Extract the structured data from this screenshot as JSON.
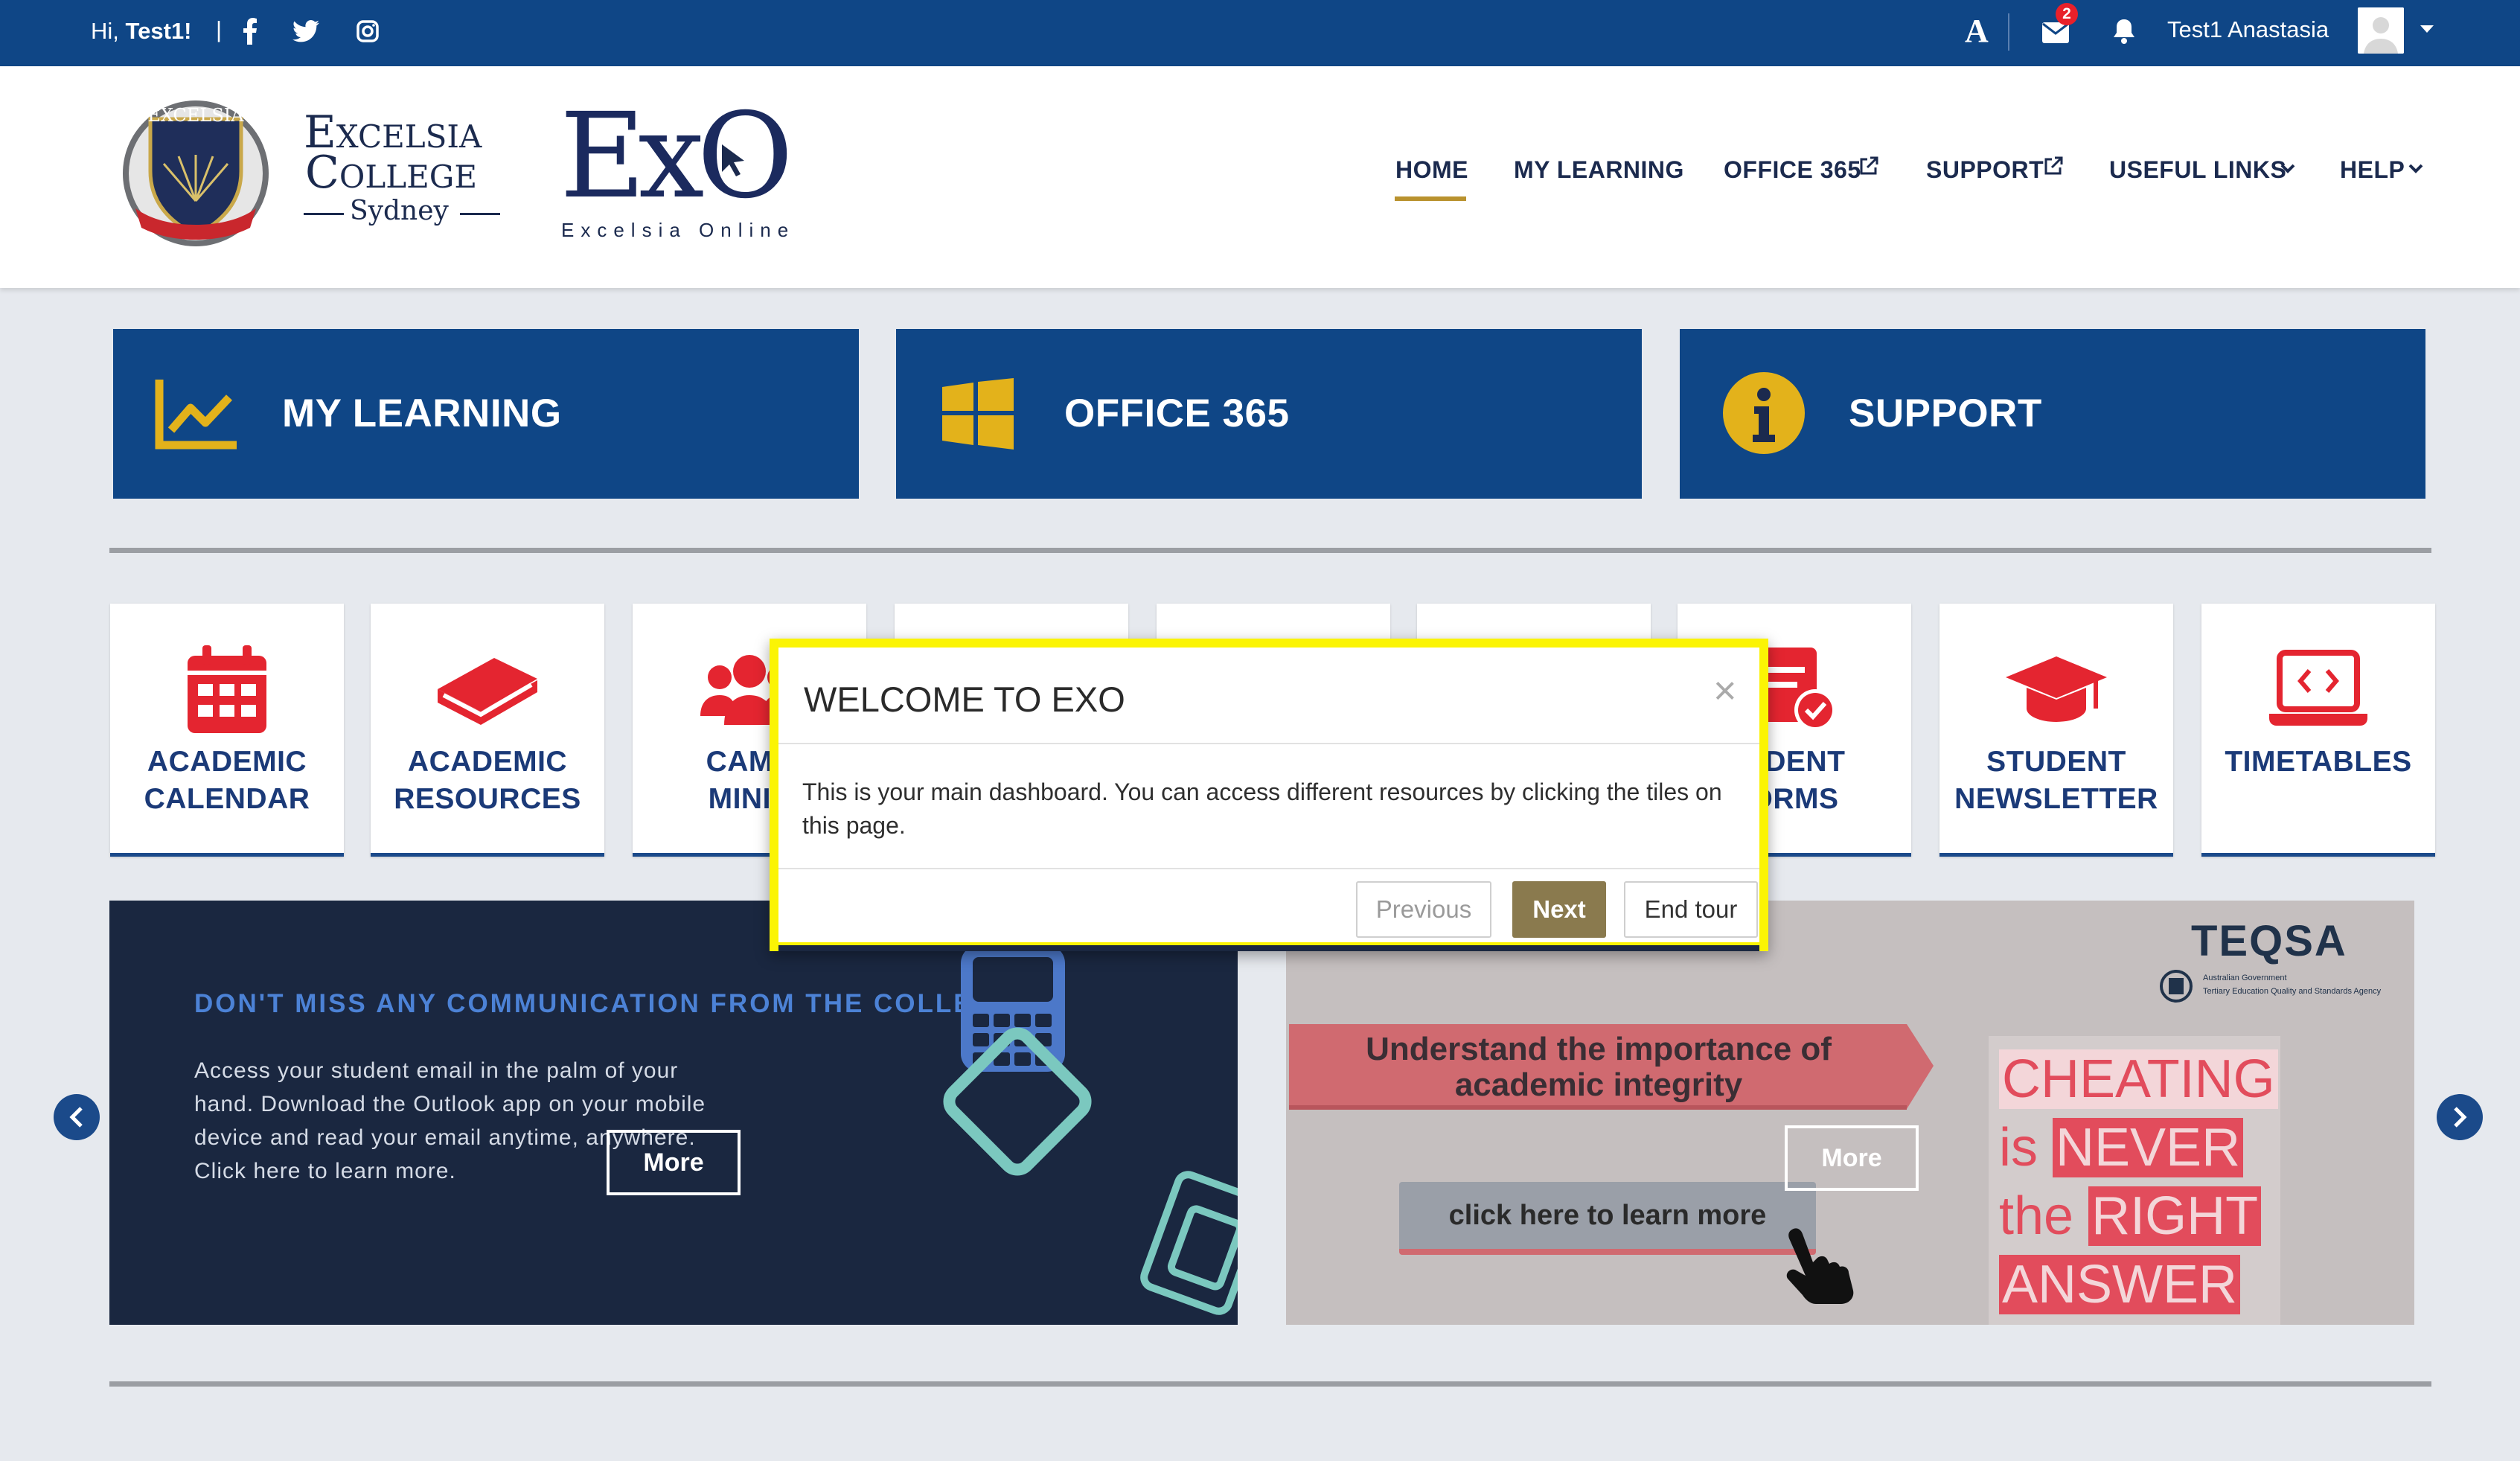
{
  "topbar": {
    "greeting_prefix": "Hi, ",
    "greeting_name": "Test1!",
    "separator": "|",
    "social_icons": [
      "facebook-icon",
      "twitter-icon",
      "instagram-icon"
    ],
    "accessibility_icon": "A",
    "mail_badge": "2",
    "user_name": "Test1 Anastasia",
    "colors": {
      "bar": "#0f4686",
      "badge": "#e8202a"
    }
  },
  "header": {
    "logo1_line1": "Excelsia",
    "logo1_line2": "College",
    "logo1_line3": "Sydney",
    "logo1_crest_text": "EXCELSIA",
    "logo2_main": "ExO",
    "logo2_sub": "Excelsia Online",
    "nav": [
      {
        "label": "HOME",
        "active": true
      },
      {
        "label": "MY LEARNING"
      },
      {
        "label": "OFFICE 365",
        "icon": "external-link-icon"
      },
      {
        "label": "SUPPORT",
        "icon": "external-link-icon"
      },
      {
        "label": "USEFUL LINKS",
        "icon": "chevron-down-icon"
      },
      {
        "label": "HELP",
        "icon": "chevron-down-icon"
      }
    ],
    "accent": "#b9922e"
  },
  "big_tiles": [
    {
      "label": "MY LEARNING",
      "icon": "line-chart-icon"
    },
    {
      "label": "OFFICE 365",
      "icon": "windows-icon"
    },
    {
      "label": "SUPPORT",
      "icon": "info-icon"
    }
  ],
  "tiles": [
    {
      "line1": "ACADEMIC",
      "line2": "CALENDAR",
      "icon": "calendar-icon"
    },
    {
      "line1": "ACADEMIC",
      "line2": "RESOURCES",
      "icon": "book-icon"
    },
    {
      "line1": "CAMP",
      "line2": "MINIS",
      "icon": "users-icon"
    },
    {
      "line1": "",
      "line2": "",
      "icon": ""
    },
    {
      "line1": "",
      "line2": "",
      "icon": ""
    },
    {
      "line1": "",
      "line2": "",
      "icon": ""
    },
    {
      "line1": "UDENT",
      "line2": "ORMS",
      "icon": "form-check-icon"
    },
    {
      "line1": "STUDENT",
      "line2": "NEWSLETTER",
      "icon": "graduation-cap-icon"
    },
    {
      "line1": "TIMETABLES",
      "line2": "",
      "icon": "laptop-code-icon"
    }
  ],
  "banner1": {
    "heading": "DON'T MISS ANY COMMUNICATION FROM THE COLLEGE",
    "body_lines": [
      "Access your student email in the palm of your",
      "hand. Download the Outlook app on your mobile",
      "device and read your email anytime, anywhere.",
      "Click here to learn more."
    ],
    "more": "More"
  },
  "banner2": {
    "teqsa": "TEQSA",
    "gov_line1": "Australian Government",
    "gov_line2": "Tertiary Education Quality and Standards Agency",
    "ribbon_line1": "Understand the importance of",
    "ribbon_line2": "academic integrity",
    "cta": "click here to learn more",
    "sign": [
      "CHEATING",
      "is",
      "NEVER",
      "the",
      "RIGHT",
      "ANSWER"
    ],
    "more": "More"
  },
  "tour": {
    "title": "WELCOME TO EXO",
    "close": "×",
    "body": "This is your main dashboard. You can access different resources by clicking the tiles on this page.",
    "previous": "Previous",
    "next": "Next",
    "end": "End tour",
    "highlight": "#fbf404"
  }
}
